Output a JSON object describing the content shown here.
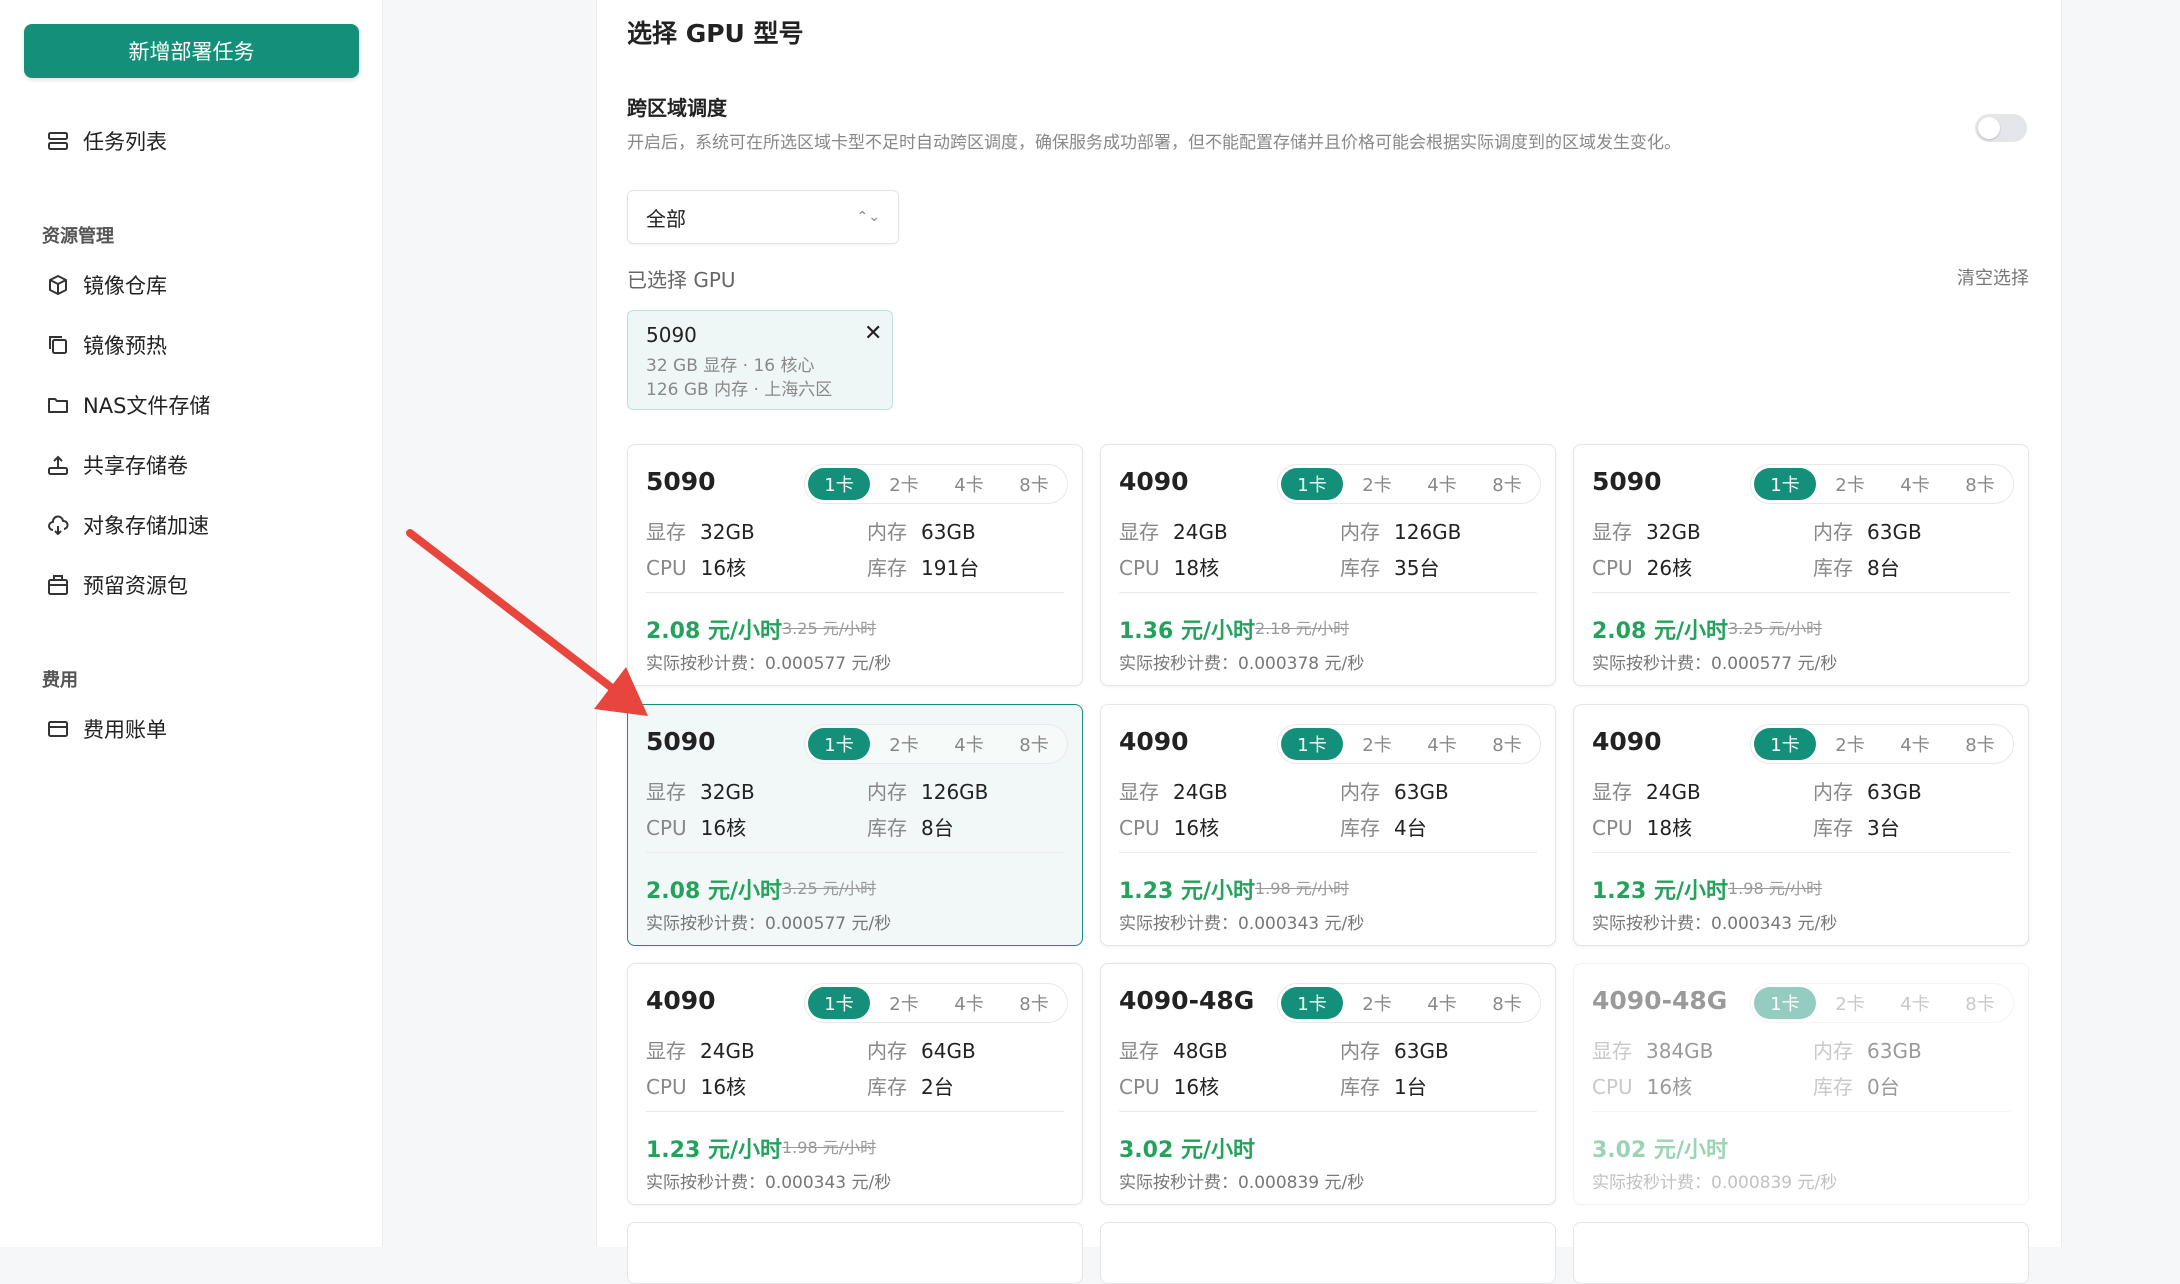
{
  "sidebar": {
    "new_task": "新增部署任务",
    "task_list": "任务列表",
    "group_resources": "资源管理",
    "items": [
      {
        "label": "镜像仓库"
      },
      {
        "label": "镜像预热"
      },
      {
        "label": "NAS文件存储"
      },
      {
        "label": "共享存储卷"
      },
      {
        "label": "对象存储加速"
      },
      {
        "label": "预留资源包"
      }
    ],
    "group_billing": "费用",
    "billing_item": "费用账单"
  },
  "main": {
    "section_title": "选择 GPU 型号",
    "cross_region": {
      "title": "跨区域调度",
      "desc": "开启后，系统可在所选区域卡型不足时自动跨区调度，确保服务成功部署，但不能配置存储并且价格可能会根据实际调度到的区域发生变化。",
      "enabled": false
    },
    "region_select": {
      "value": "全部"
    },
    "selected_label": "已选择 GPU",
    "clear_label": "清空选择",
    "chip": {
      "name": "5090",
      "line1": "32 GB 显存 · 16 核心",
      "line2": "126 GB 内存 · 上海六区"
    },
    "card_options": [
      "1卡",
      "2卡",
      "4卡",
      "8卡"
    ],
    "spec_keys": {
      "vram": "显存",
      "mem": "内存",
      "cpu": "CPU",
      "stock": "库存"
    },
    "cards": [
      {
        "name": "5090",
        "vram": "32GB",
        "mem": "63GB",
        "cpu": "16核",
        "stock": "191台",
        "price": "2.08 元/小时",
        "orig": "3.25 元/小时",
        "persec": "实际按秒计费：0.000577 元/秒"
      },
      {
        "name": "4090",
        "vram": "24GB",
        "mem": "126GB",
        "cpu": "18核",
        "stock": "35台",
        "price": "1.36 元/小时",
        "orig": "2.18 元/小时",
        "persec": "实际按秒计费：0.000378 元/秒"
      },
      {
        "name": "5090",
        "vram": "32GB",
        "mem": "63GB",
        "cpu": "26核",
        "stock": "8台",
        "price": "2.08 元/小时",
        "orig": "3.25 元/小时",
        "persec": "实际按秒计费：0.000577 元/秒"
      },
      {
        "name": "5090",
        "vram": "32GB",
        "mem": "126GB",
        "cpu": "16核",
        "stock": "8台",
        "price": "2.08 元/小时",
        "orig": "3.25 元/小时",
        "persec": "实际按秒计费：0.000577 元/秒",
        "selected": true
      },
      {
        "name": "4090",
        "vram": "24GB",
        "mem": "63GB",
        "cpu": "16核",
        "stock": "4台",
        "price": "1.23 元/小时",
        "orig": "1.98 元/小时",
        "persec": "实际按秒计费：0.000343 元/秒"
      },
      {
        "name": "4090",
        "vram": "24GB",
        "mem": "63GB",
        "cpu": "18核",
        "stock": "3台",
        "price": "1.23 元/小时",
        "orig": "1.98 元/小时",
        "persec": "实际按秒计费：0.000343 元/秒"
      },
      {
        "name": "4090",
        "vram": "24GB",
        "mem": "64GB",
        "cpu": "16核",
        "stock": "2台",
        "price": "1.23 元/小时",
        "orig": "1.98 元/小时",
        "persec": "实际按秒计费：0.000343 元/秒"
      },
      {
        "name": "4090-48G",
        "vram": "48GB",
        "mem": "63GB",
        "cpu": "16核",
        "stock": "1台",
        "price": "3.02 元/小时",
        "orig": "",
        "persec": "实际按秒计费：0.000839 元/秒"
      },
      {
        "name": "4090-48G",
        "vram": "384GB",
        "mem": "63GB",
        "cpu": "16核",
        "stock": "0台",
        "price": "3.02 元/小时",
        "orig": "",
        "persec": "实际按秒计费：0.000839 元/秒",
        "disabled": true
      }
    ]
  },
  "colors": {
    "brand": "#14907a",
    "price": "#23a25c",
    "annotation_arrow": "#e8453c"
  }
}
